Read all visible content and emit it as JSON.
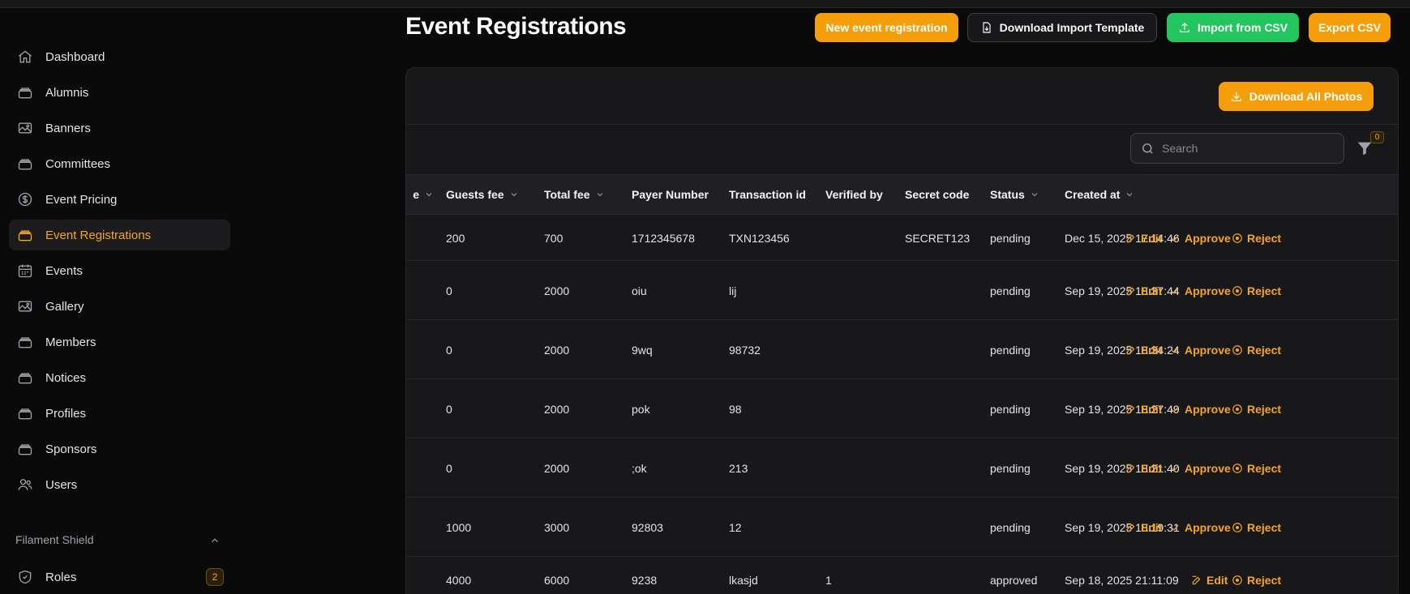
{
  "nav": {
    "items": [
      {
        "label": "Dashboard",
        "icon": "home-icon"
      },
      {
        "label": "Alumnis",
        "icon": "stack-icon"
      },
      {
        "label": "Banners",
        "icon": "photo-icon"
      },
      {
        "label": "Committees",
        "icon": "stack-icon"
      },
      {
        "label": "Event Pricing",
        "icon": "dollar-icon"
      },
      {
        "label": "Event Registrations",
        "icon": "stack-icon",
        "active": true
      },
      {
        "label": "Events",
        "icon": "calendar-icon"
      },
      {
        "label": "Gallery",
        "icon": "photo-icon"
      },
      {
        "label": "Members",
        "icon": "stack-icon"
      },
      {
        "label": "Notices",
        "icon": "stack-icon"
      },
      {
        "label": "Profiles",
        "icon": "stack-icon"
      },
      {
        "label": "Sponsors",
        "icon": "stack-icon"
      },
      {
        "label": "Users",
        "icon": "users-icon"
      }
    ],
    "group_label": "Filament Shield",
    "roles": {
      "label": "Roles",
      "badge": "2",
      "icon": "shield-icon"
    }
  },
  "header": {
    "title": "Event Registrations",
    "new_label": "New event registration",
    "template_label": "Download Import Template",
    "import_label": "Import from CSV",
    "export_label": "Export CSV"
  },
  "toolbar": {
    "download_photos_label": "Download All Photos",
    "search_placeholder": "Search",
    "filter_count": "0"
  },
  "table": {
    "columns": [
      "Guests fee",
      "Total fee",
      "Payer Number",
      "Transaction id",
      "Verified by",
      "Secret code",
      "Status",
      "Created at"
    ],
    "rows": [
      {
        "guests_fee": "200",
        "total_fee": "700",
        "payer": "1712345678",
        "txn": "TXN123456",
        "verified": "",
        "secret": "SECRET123",
        "status": "pending",
        "created": "Dec 15, 2025 17:14:46"
      },
      {
        "guests_fee": "0",
        "total_fee": "2000",
        "payer": "oiu",
        "txn": "lij",
        "verified": "",
        "secret": "",
        "status": "pending",
        "created": "Sep 19, 2025 18:37:44"
      },
      {
        "guests_fee": "0",
        "total_fee": "2000",
        "payer": "9wq",
        "txn": "98732",
        "verified": "",
        "secret": "",
        "status": "pending",
        "created": "Sep 19, 2025 18:34:24"
      },
      {
        "guests_fee": "0",
        "total_fee": "2000",
        "payer": "pok",
        "txn": "98",
        "verified": "",
        "secret": "",
        "status": "pending",
        "created": "Sep 19, 2025 18:27:49"
      },
      {
        "guests_fee": "0",
        "total_fee": "2000",
        "payer": ";ok",
        "txn": "213",
        "verified": "",
        "secret": "",
        "status": "pending",
        "created": "Sep 19, 2025 18:21:40"
      },
      {
        "guests_fee": "1000",
        "total_fee": "3000",
        "payer": "92803",
        "txn": "12",
        "verified": "",
        "secret": "",
        "status": "pending",
        "created": "Sep 19, 2025 18:19:31"
      },
      {
        "guests_fee": "4000",
        "total_fee": "6000",
        "payer": "9238",
        "txn": "lkasjd",
        "verified": "1",
        "secret": "",
        "status": "approved",
        "created": "Sep 18, 2025 21:11:09"
      }
    ],
    "actions": {
      "edit": "Edit",
      "approve": "Approve",
      "reject": "Reject"
    }
  }
}
